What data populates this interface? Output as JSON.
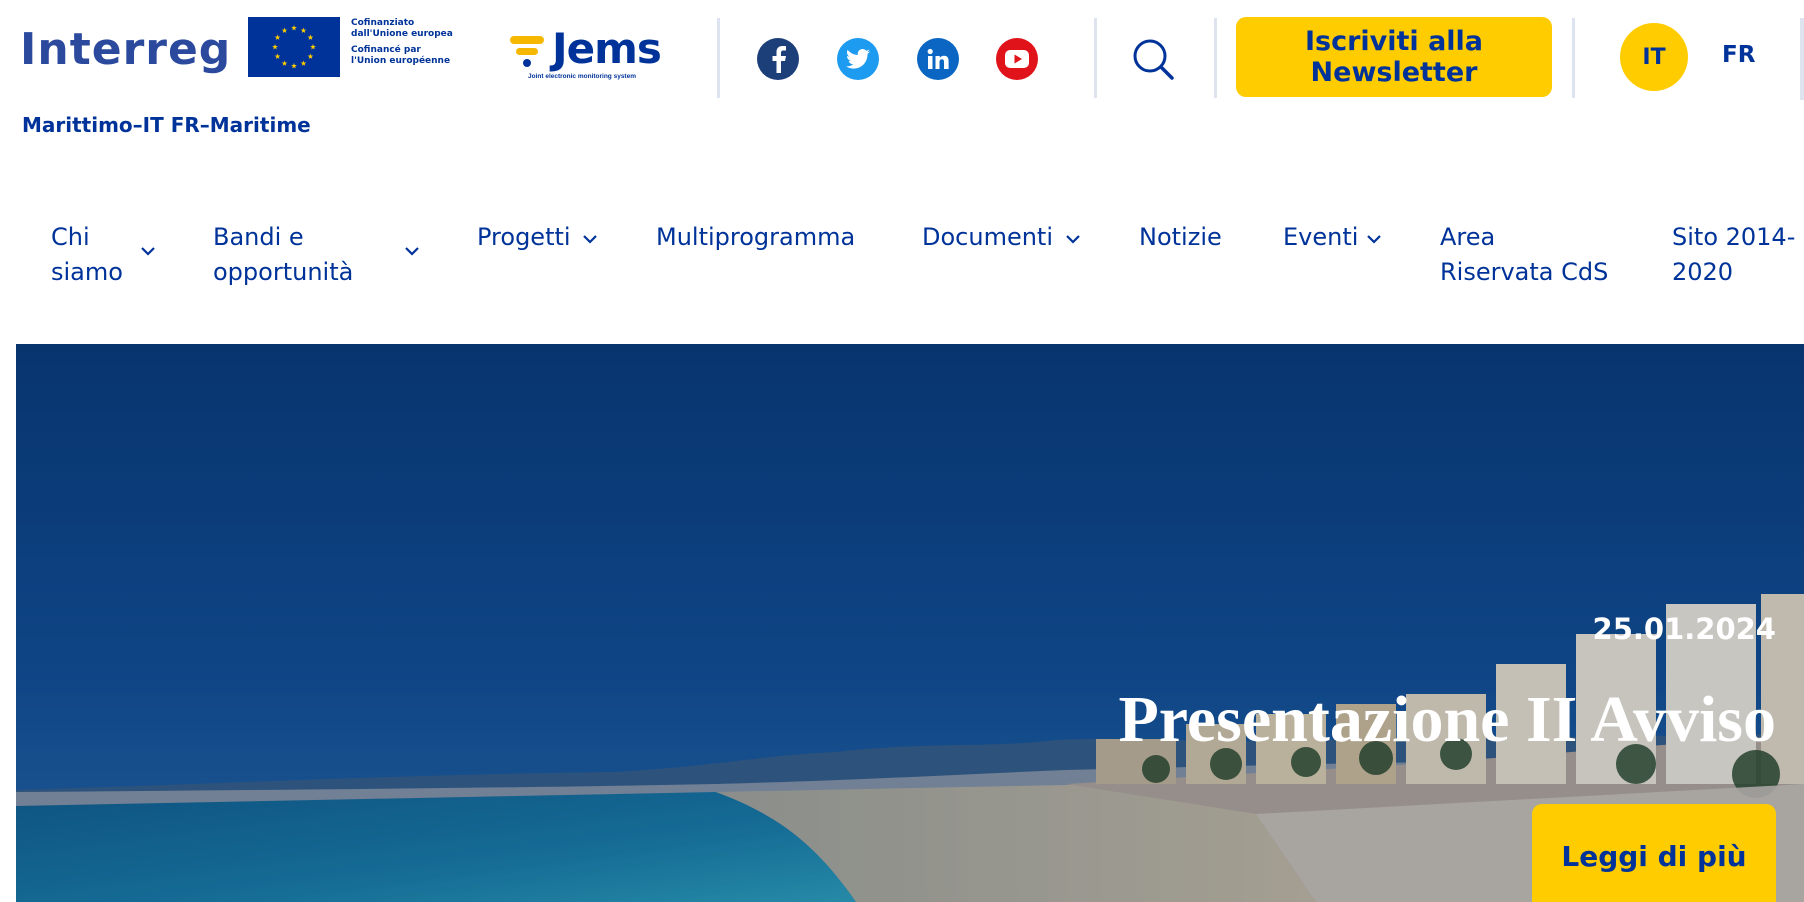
{
  "header": {
    "logo_text": "Interreg",
    "eu_cofunding": {
      "it_line1": "Cofinanziato",
      "it_line2": "dall'Unione europea",
      "fr_line1": "Cofinancé par",
      "fr_line2": "l'Union européenne"
    },
    "programme_name": "Marittimo–IT FR–Maritime",
    "jems": {
      "title": "Jems",
      "tagline": "Joint electronic monitoring system"
    },
    "social_icons": [
      "facebook-icon",
      "twitter-icon",
      "linkedin-icon",
      "youtube-icon"
    ],
    "search_icon": "search-icon",
    "newsletter_button": "Iscriviti alla Newsletter",
    "languages": {
      "active": "IT",
      "other": "FR"
    }
  },
  "nav": {
    "items": [
      {
        "label": "Chi siamo",
        "has_dropdown": true
      },
      {
        "label": "Bandi e opportunità",
        "has_dropdown": true
      },
      {
        "label": "Progetti",
        "has_dropdown": true
      },
      {
        "label": "Multiprogramma",
        "has_dropdown": false
      },
      {
        "label": "Documenti",
        "has_dropdown": true
      },
      {
        "label": "Notizie",
        "has_dropdown": false
      },
      {
        "label": "Eventi",
        "has_dropdown": true
      },
      {
        "label": "Area Riservata CdS",
        "has_dropdown": false
      },
      {
        "label": "Sito 2014-2020",
        "has_dropdown": false
      }
    ]
  },
  "hero": {
    "date": "25.01.2024",
    "title": "Presentazione II Avviso",
    "button": "Leggi di più"
  },
  "colors": {
    "primary_blue": "#003399",
    "accent_yellow": "#ffcc00",
    "facebook": "#1c3f7a",
    "twitter": "#1d9bf0",
    "linkedin": "#0a66c2",
    "youtube": "#e0121a"
  }
}
